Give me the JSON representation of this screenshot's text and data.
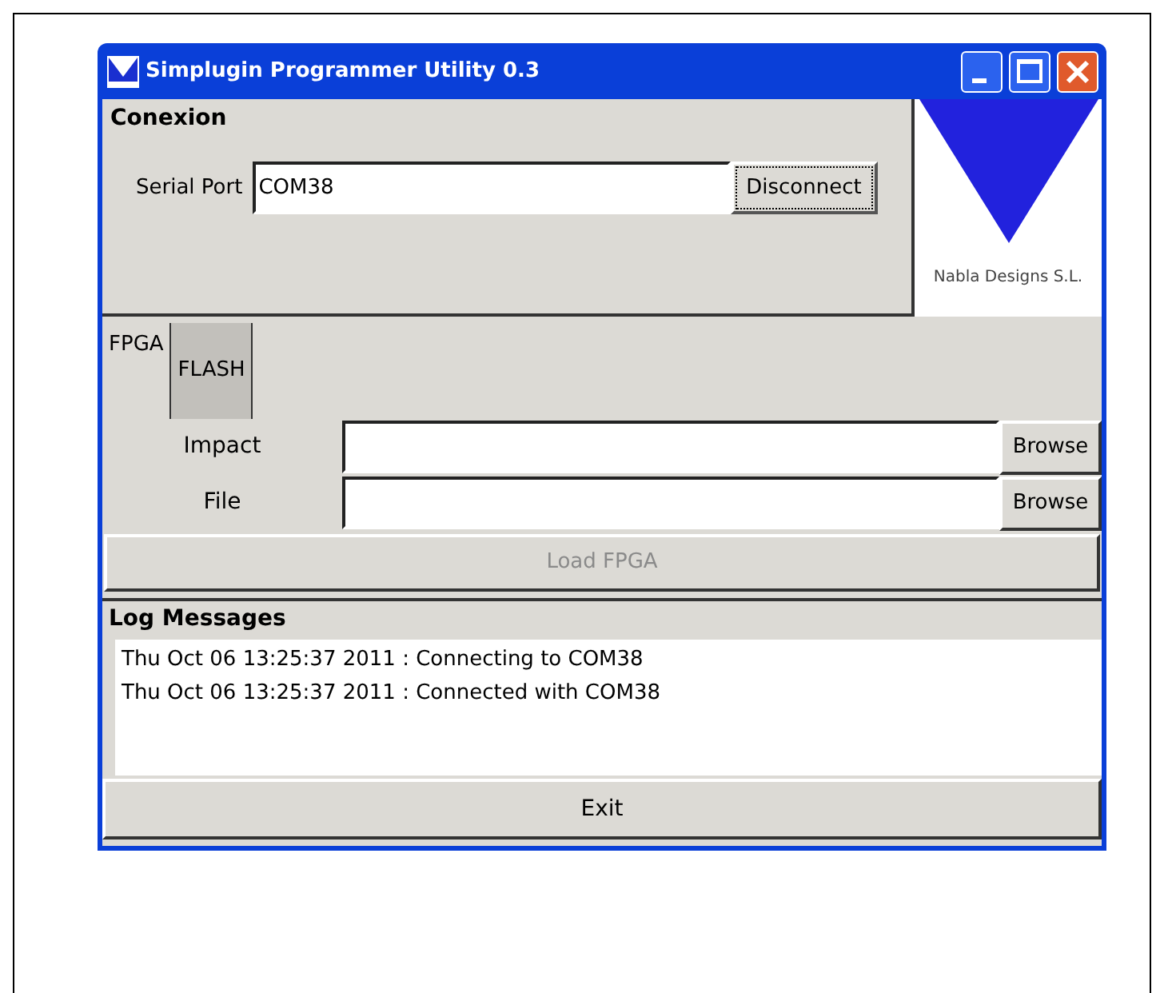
{
  "window": {
    "title": "Simplugin Programmer Utility 0.3"
  },
  "conexion": {
    "title": "Conexion",
    "label": "Serial Port",
    "value": "COM38",
    "button": "Disconnect"
  },
  "logo": {
    "caption": "Nabla Designs S.L."
  },
  "tabs": [
    {
      "label": "FPGA",
      "selected": true
    },
    {
      "label": "FLASH",
      "selected": false
    }
  ],
  "files": [
    {
      "label": "Impact",
      "button": "Browse"
    },
    {
      "label": "File",
      "button": "Browse"
    }
  ],
  "load_button": {
    "label": "Load FPGA",
    "disabled": true
  },
  "log": {
    "title": "Log Messages",
    "messages": [
      "Thu Oct 06 13:25:37 2011 : Connecting to COM38",
      "Thu Oct 06 13:25:37 2011 : Connected with COM38"
    ]
  },
  "exit_button": "Exit"
}
